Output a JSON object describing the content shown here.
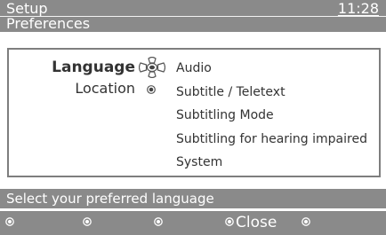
{
  "header": {
    "title": "Setup",
    "clock": "11:28",
    "subtitle": "Preferences"
  },
  "menu": {
    "selected_item": "Language",
    "second_item": "Location",
    "submenu": [
      "Audio",
      "Subtitle / Teletext",
      "Subtitling Mode",
      "Subtitling for hearing impaired",
      "System"
    ]
  },
  "hint": "Select your preferred language",
  "footer": {
    "close_label": "Close"
  },
  "icons": {
    "navigator": "navigation-cross-icon",
    "bullet": "ok-bullet-icon",
    "footer_bullets": "color-key-icon"
  },
  "colors": {
    "bar": "#8a8a8a",
    "text": "#333333",
    "panel_border": "#7e7e7e"
  }
}
